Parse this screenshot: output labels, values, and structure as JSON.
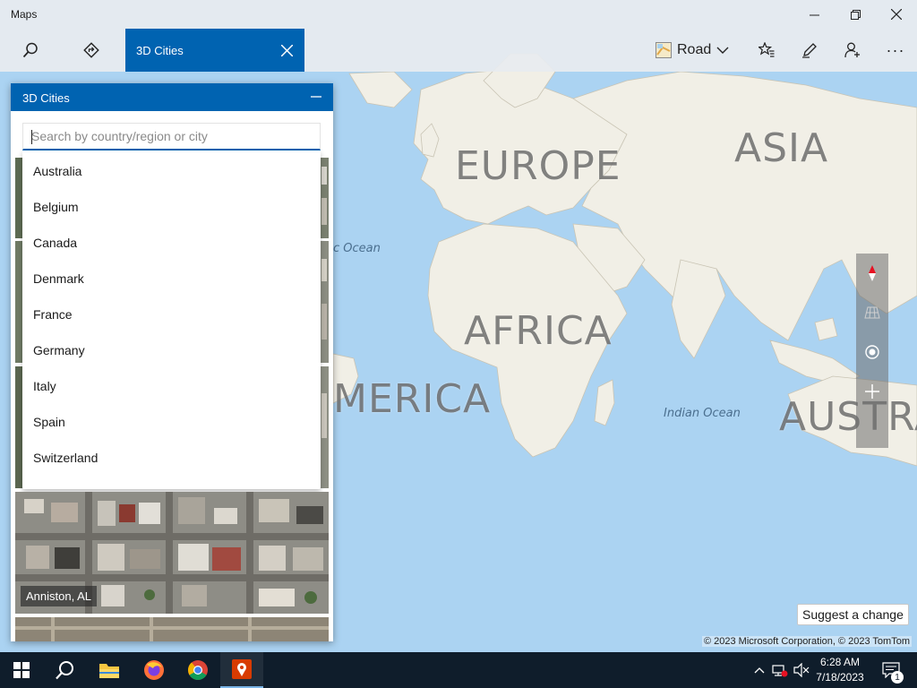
{
  "window": {
    "title": "Maps",
    "minimize_glyph": "—",
    "restore_glyph": "❐",
    "close_glyph": "✕"
  },
  "toolbar": {
    "search_icon": "search-icon",
    "directions_icon": "directions-icon",
    "active_tab_label": "3D Cities",
    "map_style_label": "Road",
    "favorites_icon": "favorites-icon",
    "ink_icon": "ink-pen-icon",
    "account_icon": "add-person-icon",
    "more_glyph": "···"
  },
  "panel": {
    "title": "3D Cities",
    "minimize_glyph": "—",
    "search_placeholder": "Search by country/region or city",
    "search_value": "",
    "countries": [
      "Australia",
      "Belgium",
      "Canada",
      "Denmark",
      "France",
      "Germany",
      "Italy",
      "Spain",
      "Switzerland"
    ],
    "featured_city": "Anniston, AL"
  },
  "map": {
    "labels": {
      "europe": "EUROPE",
      "asia": "ASIA",
      "africa": "AFRICA",
      "america": "MERICA",
      "australia": "AUSTRA"
    },
    "oceans": {
      "atlantic": "c Ocean",
      "indian": "Indian Ocean"
    },
    "controls": [
      "compass-icon",
      "3d-tilt-icon",
      "locate-me-icon",
      "zoom-in-icon"
    ],
    "suggest_label": "Suggest a change",
    "copyright": "© 2023 Microsoft Corporation, © 2023 TomTom"
  },
  "taskbar": {
    "apps": [
      "windows-start-icon",
      "search-icon",
      "file-explorer-icon",
      "firefox-icon",
      "chrome-icon",
      "maps-app-icon"
    ],
    "time": "6:28 AM",
    "date": "7/18/2023",
    "notification_count": "1"
  },
  "colors": {
    "accent": "#0063b1",
    "ocean": "#abd3f2",
    "land": "#f1efe6",
    "taskbar": "#0f1d2b"
  }
}
